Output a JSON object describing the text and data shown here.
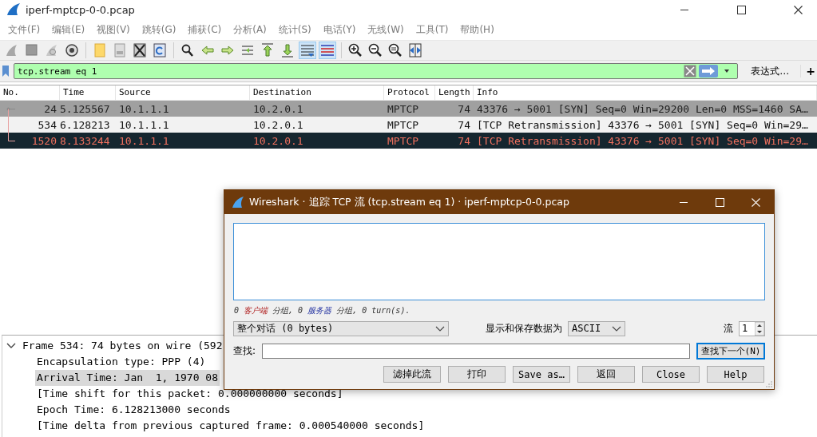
{
  "window": {
    "title": "iperf-mptcp-0-0.pcap"
  },
  "menu": [
    "文件(F)",
    "编辑(E)",
    "视图(V)",
    "跳转(G)",
    "捕获(C)",
    "分析(A)",
    "统计(S)",
    "电话(Y)",
    "无线(W)",
    "工具(T)",
    "帮助(H)"
  ],
  "toolbar": [
    {
      "kind": "start",
      "on": false
    },
    {
      "kind": "stop",
      "on": false
    },
    {
      "kind": "restart",
      "on": false
    },
    {
      "kind": "options",
      "on": false
    },
    {
      "kind": "open",
      "on": false
    },
    {
      "kind": "save",
      "on": false
    },
    {
      "kind": "close",
      "on": false
    },
    {
      "kind": "reload",
      "on": false
    },
    {
      "kind": "find",
      "on": false
    },
    {
      "kind": "back",
      "on": false
    },
    {
      "kind": "forward",
      "on": false
    },
    {
      "kind": "goto",
      "on": false
    },
    {
      "kind": "first",
      "on": false
    },
    {
      "kind": "last",
      "on": false
    },
    {
      "kind": "autoscroll",
      "on": true
    },
    {
      "kind": "colorize",
      "on": true
    },
    {
      "kind": "zoom_in",
      "on": false
    },
    {
      "kind": "zoom_out",
      "on": false
    },
    {
      "kind": "zoom_reset",
      "on": false
    },
    {
      "kind": "resize",
      "on": false
    }
  ],
  "filter": {
    "value": "tcp.stream eq 1",
    "expression_label": "表达式…",
    "add_label": "+"
  },
  "packet_list": {
    "columns": [
      "No.",
      "Time",
      "Source",
      "Destination",
      "Protocol",
      "Length",
      "Info"
    ],
    "rows": [
      {
        "no": "24",
        "time": "5.125567",
        "source": "10.1.1.1",
        "destination": "10.2.0.1",
        "protocol": "MPTCP",
        "length": "74",
        "info": "43376 → 5001 [SYN] Seq=0 Win=29200 Len=0 MSS=1460 SA…",
        "selected": false,
        "highlighted": true
      },
      {
        "no": "534",
        "time": "6.128213",
        "source": "10.1.1.1",
        "destination": "10.2.0.1",
        "protocol": "MPTCP",
        "length": "74",
        "info": "[TCP Retransmission] 43376 → 5001 [SYN] Seq=0 Win=29…",
        "selected": false,
        "highlighted": false
      },
      {
        "no": "1520",
        "time": "8.133244",
        "source": "10.1.1.1",
        "destination": "10.2.0.1",
        "protocol": "MPTCP",
        "length": "74",
        "info": "[TCP Retransmission] 43376 → 5001 [SYN] Seq=0 Win=29…",
        "selected": true,
        "highlighted": false
      }
    ]
  },
  "details": [
    {
      "text": "Frame 534: 74 bytes on wire (592",
      "expanded": true,
      "selected": false,
      "children": [
        {
          "text": "Encapsulation type: PPP (4)",
          "selected": false
        },
        {
          "text": "Arrival Time: Jan  1, 1970 08",
          "selected": true
        },
        {
          "text": "[Time shift for this packet: 0.000000000 seconds]",
          "selected": false
        },
        {
          "text": "Epoch Time: 6.128213000 seconds",
          "selected": false
        },
        {
          "text": "[Time delta from previous captured frame: 0.000540000 seconds]",
          "selected": false
        }
      ]
    }
  ],
  "dialog": {
    "title": "Wireshark · 追踪 TCP 流 (tcp.stream eq 1) · iperf-mptcp-0-0.pcap",
    "summary": [
      {
        "text": "0 ",
        "kind": "plain"
      },
      {
        "text": "客户端",
        "kind": "client"
      },
      {
        "text": " 分组, 0 ",
        "kind": "plain"
      },
      {
        "text": "服务器",
        "kind": "server"
      },
      {
        "text": " 分组, 0 turn(s).",
        "kind": "plain"
      }
    ],
    "conversation": "整个对话 (0 bytes)",
    "show_as_label": "显示和保存数据为",
    "show_as": "ASCII",
    "stream_label": "流",
    "stream": "1",
    "find_label": "查找:",
    "find_next": {
      "label": "查找下一个(N)",
      "focused": true
    },
    "buttons": [
      "滤掉此流",
      "打印",
      "Save as…",
      "返回",
      "Close",
      "Help"
    ]
  }
}
